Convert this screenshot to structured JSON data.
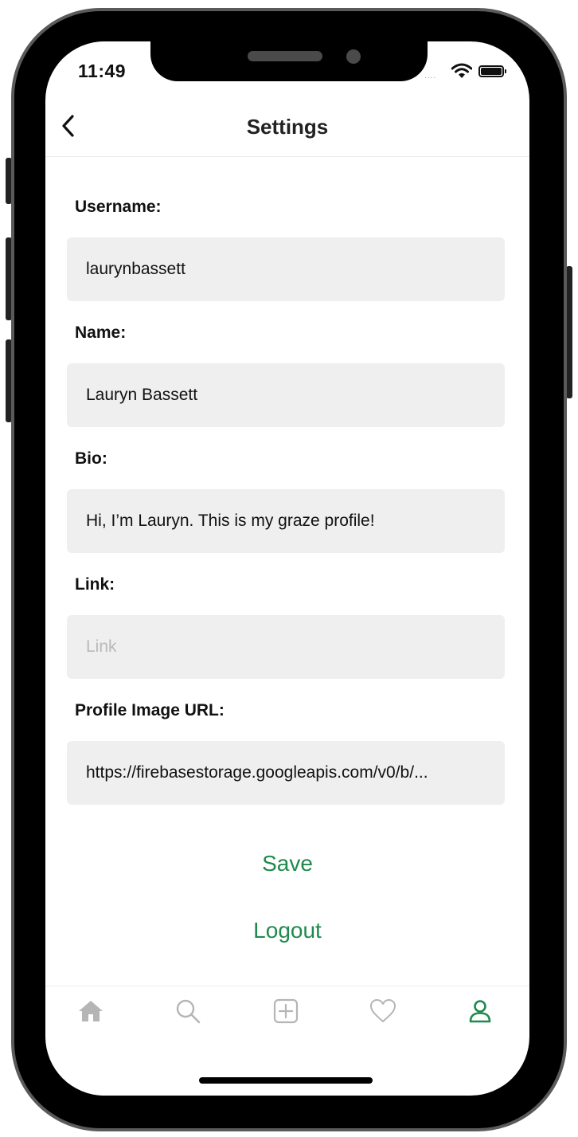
{
  "status_bar": {
    "time": "11:49",
    "signal": "....",
    "icons": [
      "wifi-icon",
      "battery-icon"
    ]
  },
  "nav": {
    "title": "Settings",
    "back_icon": "chevron-left-icon"
  },
  "form": {
    "username": {
      "label": "Username:",
      "value": "laurynbassett",
      "placeholder": ""
    },
    "name": {
      "label": "Name:",
      "value": "Lauryn Bassett",
      "placeholder": ""
    },
    "bio": {
      "label": "Bio:",
      "value": "Hi, I’m Lauryn. This is my graze profile!",
      "placeholder": ""
    },
    "link": {
      "label": "Link:",
      "value": "",
      "placeholder": "Link"
    },
    "profile_image_url": {
      "label": "Profile Image URL:",
      "value": "https://firebasestorage.googleapis.com/v0/b/...",
      "placeholder": ""
    }
  },
  "actions": {
    "save_label": "Save",
    "logout_label": "Logout"
  },
  "tab_bar": {
    "items": [
      {
        "icon": "home-icon",
        "active": false
      },
      {
        "icon": "search-icon",
        "active": false
      },
      {
        "icon": "add-square-icon",
        "active": false
      },
      {
        "icon": "heart-icon",
        "active": false
      },
      {
        "icon": "profile-icon",
        "active": true
      }
    ]
  },
  "colors": {
    "accent": "#1f8a4d",
    "inactive_icon": "#b5b5b5",
    "field_bg": "#efefef"
  }
}
